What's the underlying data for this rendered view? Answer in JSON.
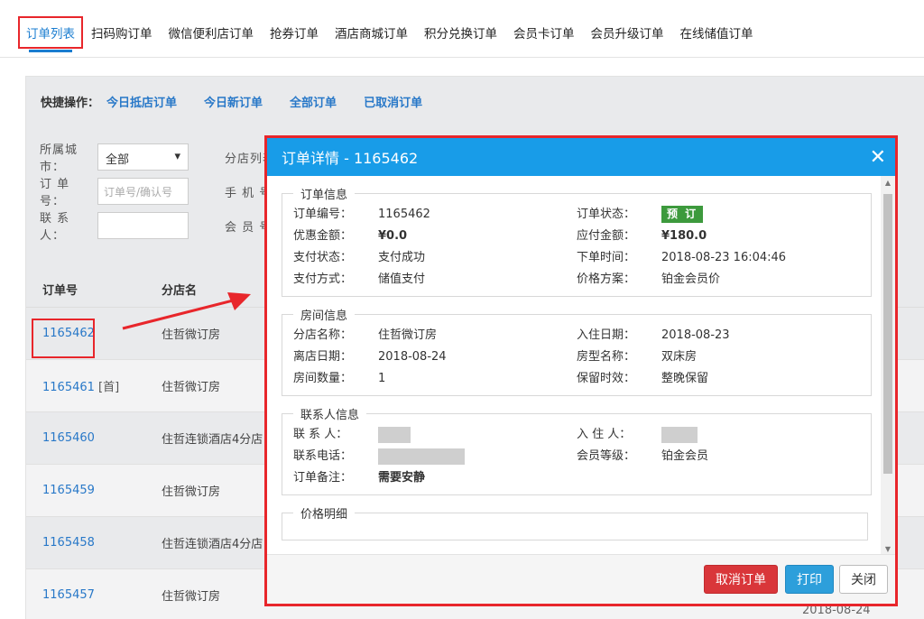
{
  "tabs": [
    {
      "label": "订单列表",
      "active": true
    },
    {
      "label": "扫码购订单"
    },
    {
      "label": "微信便利店订单"
    },
    {
      "label": "抢券订单"
    },
    {
      "label": "酒店商城订单"
    },
    {
      "label": "积分兑换订单"
    },
    {
      "label": "会员卡订单"
    },
    {
      "label": "会员升级订单"
    },
    {
      "label": "在线储值订单"
    }
  ],
  "quick": {
    "label": "快捷操作：",
    "links": [
      "今日抵店订单",
      "今日新订单",
      "全部订单",
      "已取消订单"
    ]
  },
  "filters": {
    "city_label": "所属城市：",
    "city_value": "全部",
    "order_label": "订 单 号：",
    "order_placeholder": "订单号/确认号",
    "contact_label": "联 系 人：",
    "branch_label": "分店列表",
    "phone_label": "手 机 号",
    "member_label": "会 员 号"
  },
  "list": {
    "headers": [
      "订单号",
      "分店名"
    ],
    "rows": [
      {
        "id": "1165462",
        "tag": "",
        "branch": "住哲微订房"
      },
      {
        "id": "1165461",
        "tag": "[首]",
        "branch": "住哲微订房"
      },
      {
        "id": "1165460",
        "tag": "",
        "branch": "住哲连锁酒店4分店"
      },
      {
        "id": "1165459",
        "tag": "",
        "branch": "住哲微订房"
      },
      {
        "id": "1165458",
        "tag": "",
        "branch": "住哲连锁酒店4分店"
      },
      {
        "id": "1165457",
        "tag": "",
        "branch": "住哲微订房"
      }
    ],
    "last_date": "2018-08-24"
  },
  "modal": {
    "title": "订单详情 - 1165462",
    "order_section": {
      "legend": "订单信息",
      "order_no_label": "订单编号：",
      "order_no": "1165462",
      "status_label": "订单状态：",
      "status": "预 订",
      "discount_label": "优惠金额：",
      "discount": "¥0.0",
      "payable_label": "应付金额：",
      "payable": "¥180.0",
      "pay_status_label": "支付状态：",
      "pay_status": "支付成功",
      "order_time_label": "下单时间：",
      "order_time": "2018-08-23 16:04:46",
      "pay_method_label": "支付方式：",
      "pay_method": "储值支付",
      "price_plan_label": "价格方案：",
      "price_plan": "铂金会员价"
    },
    "room_section": {
      "legend": "房间信息",
      "branch_label": "分店名称：",
      "branch": "住哲微订房",
      "checkin_label": "入住日期：",
      "checkin": "2018-08-23",
      "checkout_label": "离店日期：",
      "checkout": "2018-08-24",
      "room_type_label": "房型名称：",
      "room_type": "双床房",
      "room_count_label": "房间数量：",
      "room_count": "1",
      "hold_label": "保留时效：",
      "hold": "整晚保留"
    },
    "contact_section": {
      "legend": "联系人信息",
      "contact_label": "联 系 人：",
      "guest_label": "入 住 人：",
      "phone_label": "联系电话：",
      "level_label": "会员等级：",
      "level": "铂金会员",
      "remark_label": "订单备注：",
      "remark": "需要安静"
    },
    "price_section": {
      "legend": "价格明细"
    },
    "buttons": {
      "cancel": "取消订单",
      "print": "打印",
      "close": "关闭"
    }
  }
}
